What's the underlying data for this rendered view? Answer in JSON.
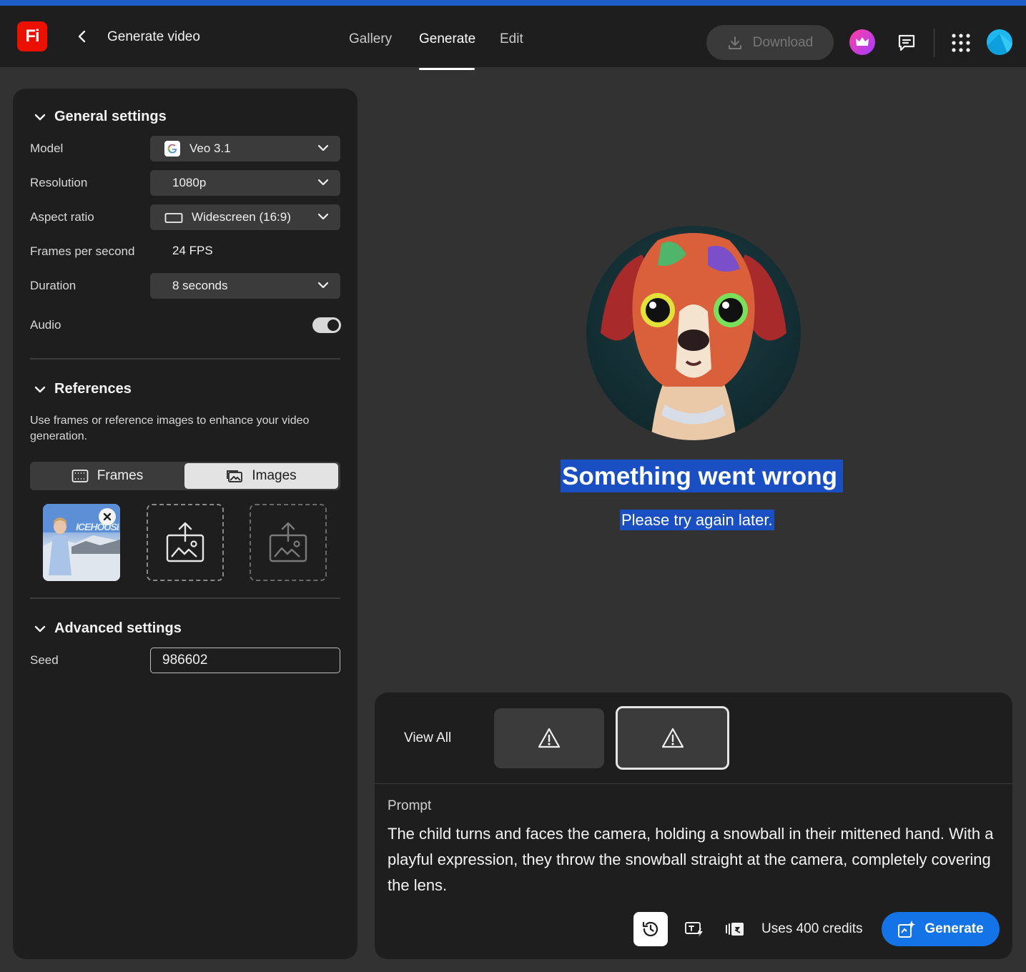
{
  "app": {
    "logo_text": "Fi",
    "page_title": "Generate video"
  },
  "nav": {
    "tabs": [
      {
        "label": "Gallery",
        "active": false
      },
      {
        "label": "Generate",
        "active": true
      },
      {
        "label": "Edit",
        "active": false
      }
    ],
    "download_label": "Download"
  },
  "general_settings": {
    "title": "General settings",
    "model_label": "Model",
    "model_value": "Veo 3.1",
    "resolution_label": "Resolution",
    "resolution_value": "1080p",
    "aspect_label": "Aspect ratio",
    "aspect_value": "Widescreen (16:9)",
    "fps_label": "Frames per second",
    "fps_value": "24 FPS",
    "duration_label": "Duration",
    "duration_value": "8 seconds",
    "audio_label": "Audio",
    "audio_on": true
  },
  "references": {
    "title": "References",
    "description": "Use frames or reference images to enhance your video generation.",
    "tabs": [
      {
        "label": "Frames",
        "selected": false
      },
      {
        "label": "Images",
        "selected": true
      }
    ],
    "image_thumbnail_text": "ICEHOUSE"
  },
  "advanced_settings": {
    "title": "Advanced settings",
    "seed_label": "Seed",
    "seed_value": "986602"
  },
  "error": {
    "title": "Something went wrong",
    "subtitle": "Please try again later."
  },
  "history": {
    "view_all_label": "View All",
    "items": [
      {
        "icon": "warning-icon",
        "selected": false
      },
      {
        "icon": "warning-icon",
        "selected": true
      }
    ]
  },
  "prompt": {
    "label": "Prompt",
    "text": "The child turns and faces the camera, holding a snowball in their mittened hand. With a playful expression, they throw the snowball straight at the camera, completely covering the lens."
  },
  "actions": {
    "credits_label": "Uses 400 credits",
    "generate_label": "Generate"
  },
  "colors": {
    "accent": "#1473e6",
    "logo": "#eb1000",
    "selection_highlight": "#1a4fc4",
    "panel": "#1e1e1e",
    "background": "#323232"
  }
}
